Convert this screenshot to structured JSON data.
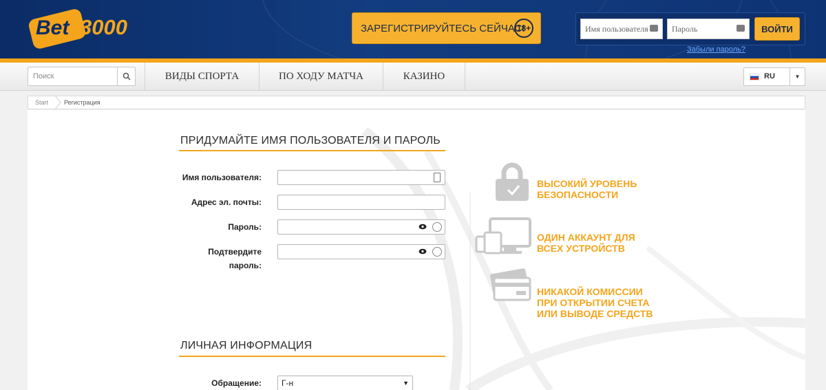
{
  "header": {
    "logo": {
      "part1": "Bet",
      "part2": "3000"
    },
    "register_button": "ЗАРЕГИСТРИРУЙТЕСЬ СЕЙЧАС!",
    "age_badge": "18+",
    "username_placeholder": "Имя пользователя",
    "password_placeholder": "Пароль",
    "login_button": "ВОЙТИ",
    "forgot_password": "Забыли пароль?"
  },
  "nav": {
    "search_placeholder": "Поиск",
    "items": [
      "ВИДЫ СПОРТА",
      "ПО ХОДУ МАТЧА",
      "КАЗИНО"
    ],
    "language": "RU"
  },
  "breadcrumb": [
    "Start",
    "Регистрация"
  ],
  "form": {
    "section1_title": "ПРИДУМАЙТЕ ИМЯ ПОЛЬЗОВАТЕЛЯ И ПАРОЛЬ",
    "username_label": "Имя пользователя:",
    "email_label": "Адрес эл. почты:",
    "password_label": "Пароль:",
    "confirm_label_line1": "Подтвердите",
    "confirm_label_line2": "пароль:",
    "section2_title": "ЛИЧНАЯ ИНФОРМАЦИЯ",
    "salutation_label": "Обращение:",
    "salutation_value": "Г-н"
  },
  "benefits": [
    {
      "icon": "lock-icon",
      "line1": "ВЫСОКИЙ УРОВЕНЬ",
      "line2": "БЕЗОПАСНОСТИ"
    },
    {
      "icon": "devices-icon",
      "line1": "ОДИН АККАУНТ ДЛЯ",
      "line2": "ВСЕХ УСТРОЙСТВ"
    },
    {
      "icon": "credit-card-icon",
      "line1": "НИКАКОЙ КОМИССИИ",
      "line2": "ПРИ ОТКРЫТИИ СЧЕТА",
      "line3": "ИЛИ ВЫВОДЕ СРЕДСТВ"
    }
  ],
  "colors": {
    "brand_blue": "#0b2c66",
    "accent_orange": "#f4a51c",
    "link_blue": "#6ea9ff"
  }
}
